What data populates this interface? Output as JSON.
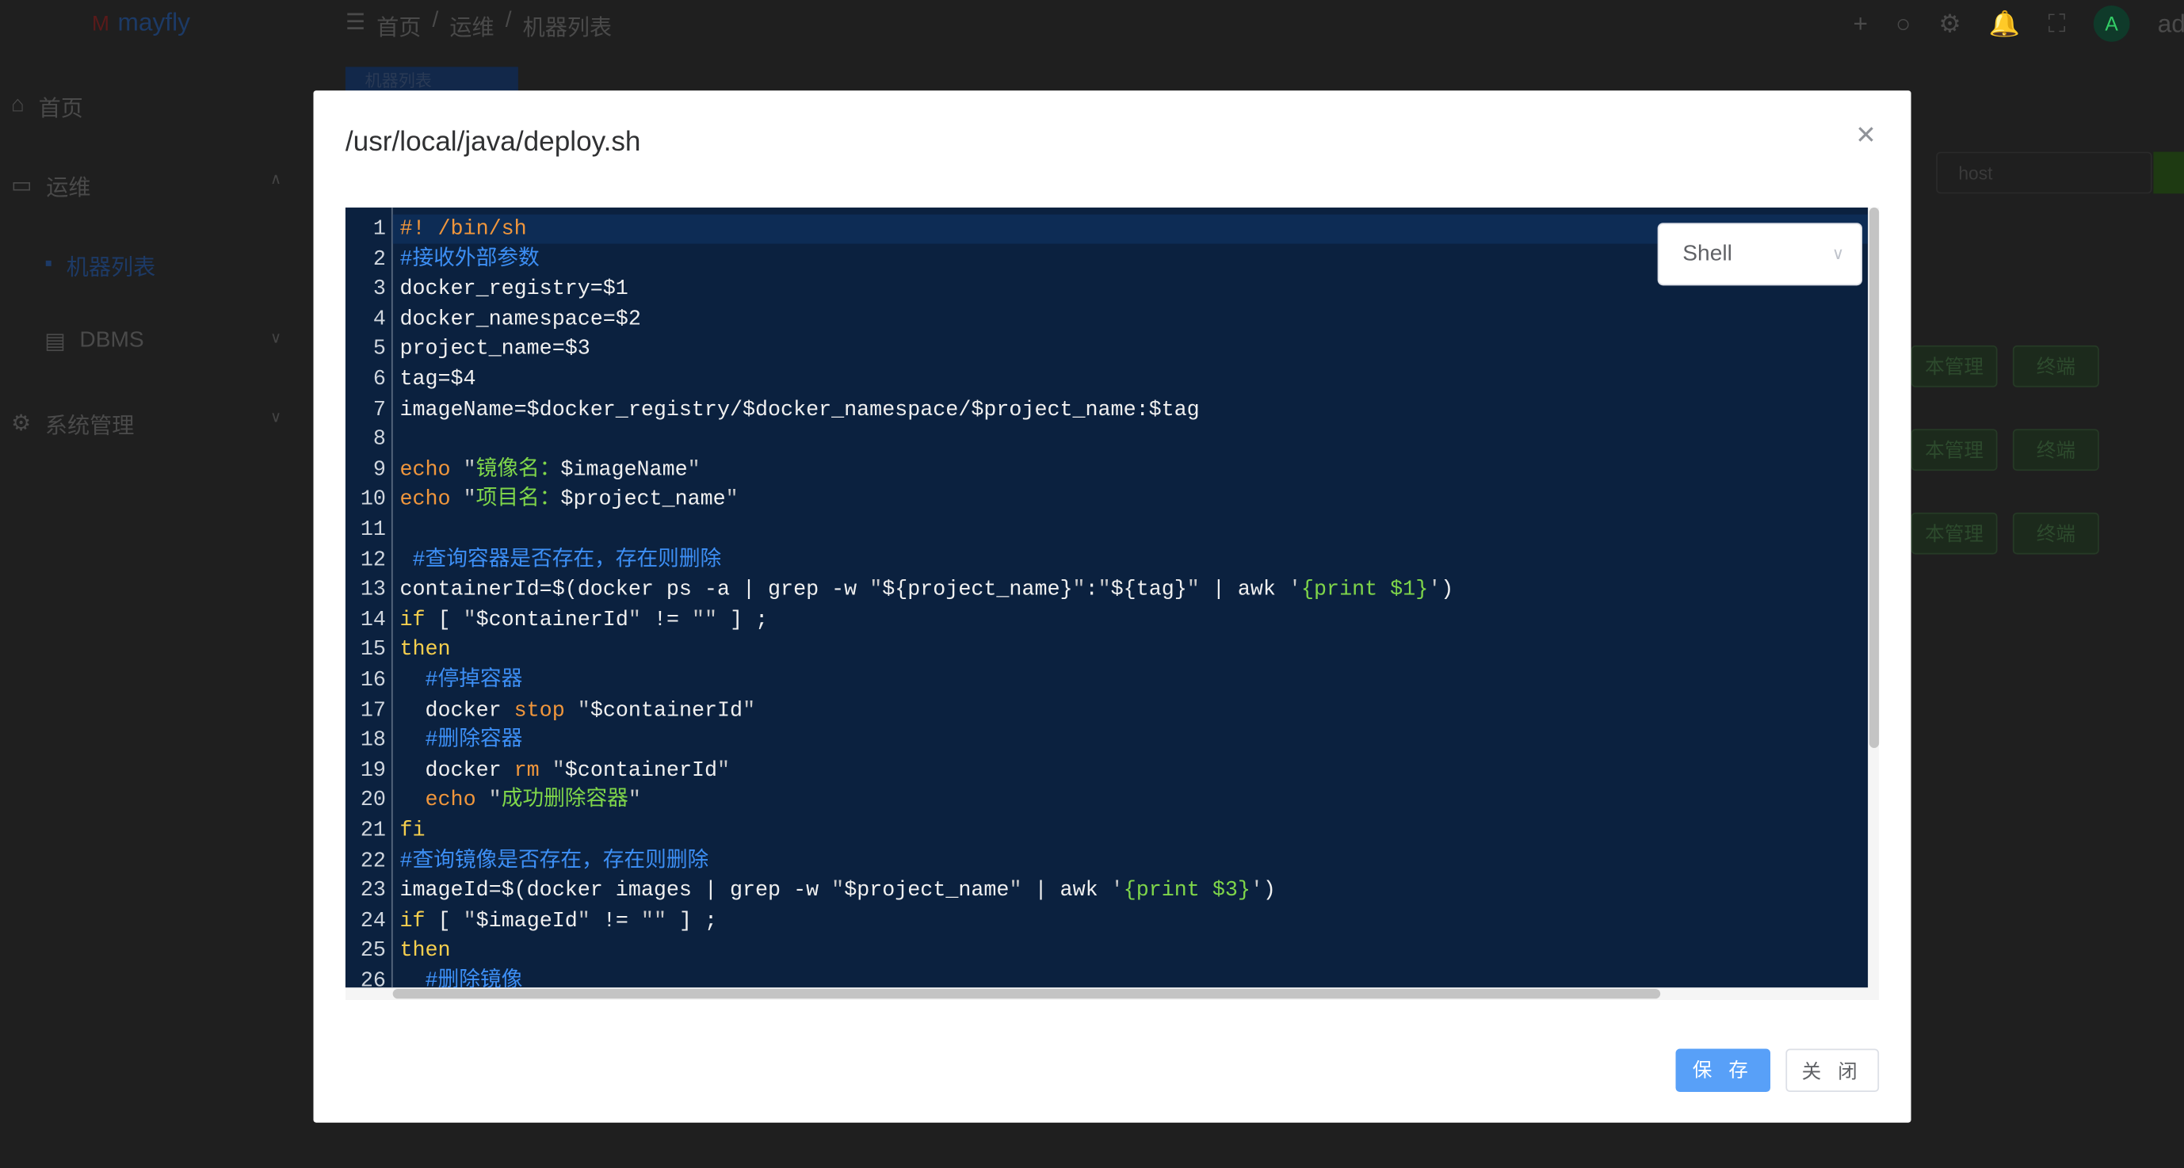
{
  "app": {
    "logo": "mayfly"
  },
  "breadcrumb": [
    "首页",
    "/",
    "运维",
    "/",
    "机器列表"
  ],
  "header": {
    "user": "admin",
    "avatar_letter": "A"
  },
  "sidebar": {
    "items": [
      {
        "label": "首页",
        "icon": "home-icon"
      },
      {
        "label": "运维",
        "icon": "monitor-icon"
      },
      {
        "label": "机器列表",
        "icon": "grid-icon"
      },
      {
        "label": "DBMS",
        "icon": "database-icon"
      },
      {
        "label": "系统管理",
        "icon": "gear-icon"
      }
    ]
  },
  "tab": {
    "label": "机器列表"
  },
  "background": {
    "host_placeholder": "host",
    "row_buttons": [
      "本管理",
      "终端"
    ]
  },
  "dialog": {
    "title": "/usr/local/java/deploy.sh",
    "language": "Shell",
    "save_label": "保 存",
    "close_label": "关 闭",
    "lines": [
      [
        [
          "sb",
          "#! /bin/sh"
        ]
      ],
      [
        [
          "cm",
          "#接收外部参数"
        ]
      ],
      [
        [
          "p",
          "docker_registry=$1"
        ]
      ],
      [
        [
          "p",
          "docker_namespace=$2"
        ]
      ],
      [
        [
          "p",
          "project_name=$3"
        ]
      ],
      [
        [
          "p",
          "tag=$4"
        ]
      ],
      [
        [
          "p",
          "imageName=$docker_registry/$docker_namespace/$project_name:$tag"
        ]
      ],
      [],
      [
        [
          "kw",
          "echo"
        ],
        [
          "p",
          " "
        ],
        [
          "q",
          "\""
        ],
        [
          "str",
          "镜像名："
        ],
        [
          "p",
          "$imageName"
        ],
        [
          "q",
          "\""
        ]
      ],
      [
        [
          "kw",
          "echo"
        ],
        [
          "p",
          " "
        ],
        [
          "q",
          "\""
        ],
        [
          "str",
          "项目名："
        ],
        [
          "p",
          "$project_name"
        ],
        [
          "q",
          "\""
        ]
      ],
      [],
      [
        [
          "p",
          " "
        ],
        [
          "cm",
          "#查询容器是否存在，存在则删除"
        ]
      ],
      [
        [
          "p",
          "containerId=$(docker ps -a | grep -w "
        ],
        [
          "q",
          "\""
        ],
        [
          "p",
          "${project_name}"
        ],
        [
          "q",
          "\""
        ],
        [
          "p",
          ":"
        ],
        [
          "q",
          "\""
        ],
        [
          "p",
          "${tag}"
        ],
        [
          "q",
          "\""
        ],
        [
          "p",
          " | awk "
        ],
        [
          "q",
          "'"
        ],
        [
          "str",
          "{print $1}"
        ],
        [
          "q",
          "'"
        ],
        [
          "p",
          ")"
        ]
      ],
      [
        [
          "ctl",
          "if"
        ],
        [
          "p",
          " [ "
        ],
        [
          "q",
          "\""
        ],
        [
          "p",
          "$containerId"
        ],
        [
          "q",
          "\""
        ],
        [
          "p",
          " != "
        ],
        [
          "q",
          "\"\""
        ],
        [
          "p",
          " ] ;"
        ]
      ],
      [
        [
          "ctl",
          "then"
        ]
      ],
      [
        [
          "p",
          "  "
        ],
        [
          "cm",
          "#停掉容器"
        ]
      ],
      [
        [
          "p",
          "  docker "
        ],
        [
          "kw",
          "stop"
        ],
        [
          "p",
          " "
        ],
        [
          "q",
          "\""
        ],
        [
          "p",
          "$containerId"
        ],
        [
          "q",
          "\""
        ]
      ],
      [
        [
          "p",
          "  "
        ],
        [
          "cm",
          "#删除容器"
        ]
      ],
      [
        [
          "p",
          "  docker "
        ],
        [
          "kw",
          "rm"
        ],
        [
          "p",
          " "
        ],
        [
          "q",
          "\""
        ],
        [
          "p",
          "$containerId"
        ],
        [
          "q",
          "\""
        ]
      ],
      [
        [
          "p",
          "  "
        ],
        [
          "kw",
          "echo"
        ],
        [
          "p",
          " "
        ],
        [
          "q",
          "\""
        ],
        [
          "str",
          "成功删除容器"
        ],
        [
          "q",
          "\""
        ]
      ],
      [
        [
          "ctl",
          "fi"
        ]
      ],
      [
        [
          "cm",
          "#查询镜像是否存在，存在则删除"
        ]
      ],
      [
        [
          "p",
          "imageId=$(docker images | grep -w "
        ],
        [
          "q",
          "\""
        ],
        [
          "p",
          "$project_name"
        ],
        [
          "q",
          "\""
        ],
        [
          "p",
          " | awk "
        ],
        [
          "q",
          "'"
        ],
        [
          "str",
          "{print $3}"
        ],
        [
          "q",
          "'"
        ],
        [
          "p",
          ")"
        ]
      ],
      [
        [
          "ctl",
          "if"
        ],
        [
          "p",
          " [ "
        ],
        [
          "q",
          "\""
        ],
        [
          "p",
          "$imageId"
        ],
        [
          "q",
          "\""
        ],
        [
          "p",
          " != "
        ],
        [
          "q",
          "\"\""
        ],
        [
          "p",
          " ] ;"
        ]
      ],
      [
        [
          "ctl",
          "then"
        ]
      ],
      [
        [
          "p",
          "  "
        ],
        [
          "cm",
          "#删除镜像"
        ]
      ]
    ]
  }
}
